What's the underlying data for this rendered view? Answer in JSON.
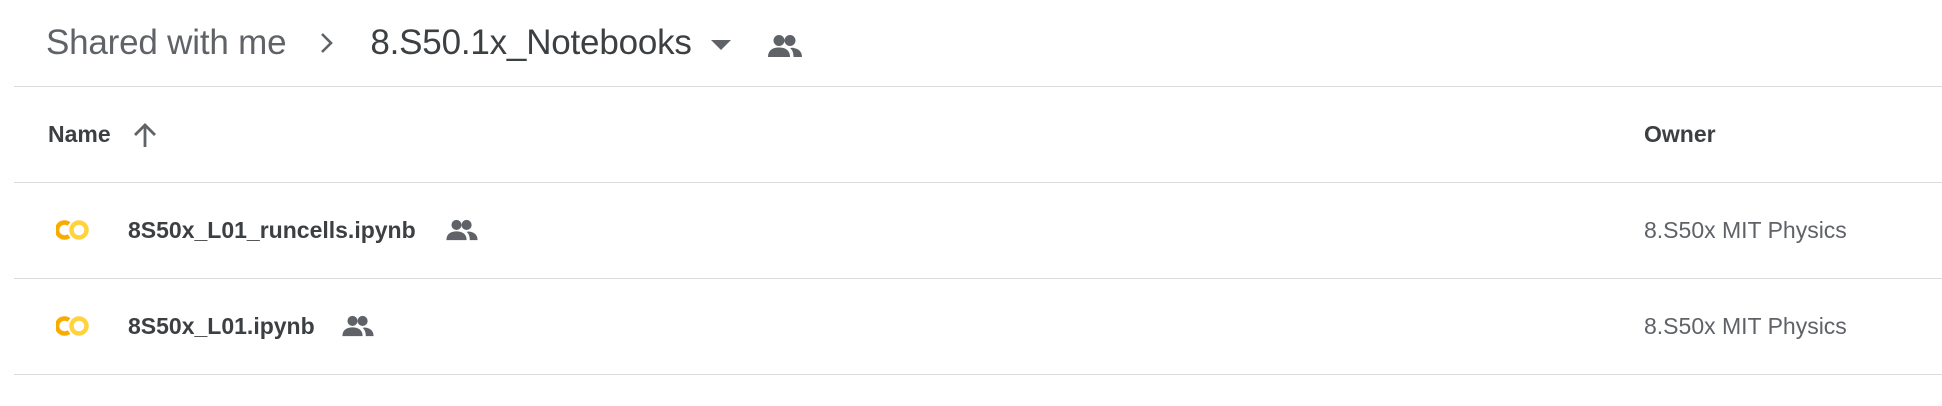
{
  "breadcrumb": {
    "parent_label": "Shared with me",
    "current_label": "8.S50.1x_Notebooks"
  },
  "table": {
    "columns": {
      "name": "Name",
      "owner": "Owner"
    },
    "sort": "ascending"
  },
  "files": [
    {
      "name": "8S50x_L01_runcells.ipynb",
      "owner": "8.S50x MIT Physics",
      "shared": true,
      "icon": "colab-icon"
    },
    {
      "name": "8S50x_L01.ipynb",
      "owner": "8.S50x MIT Physics",
      "shared": true,
      "icon": "colab-icon"
    }
  ],
  "colors": {
    "colab_orange": "#f9ab00",
    "colab_yellow": "#ffd33d",
    "icon_gray": "#5f6368",
    "divider": "#dadce0"
  }
}
